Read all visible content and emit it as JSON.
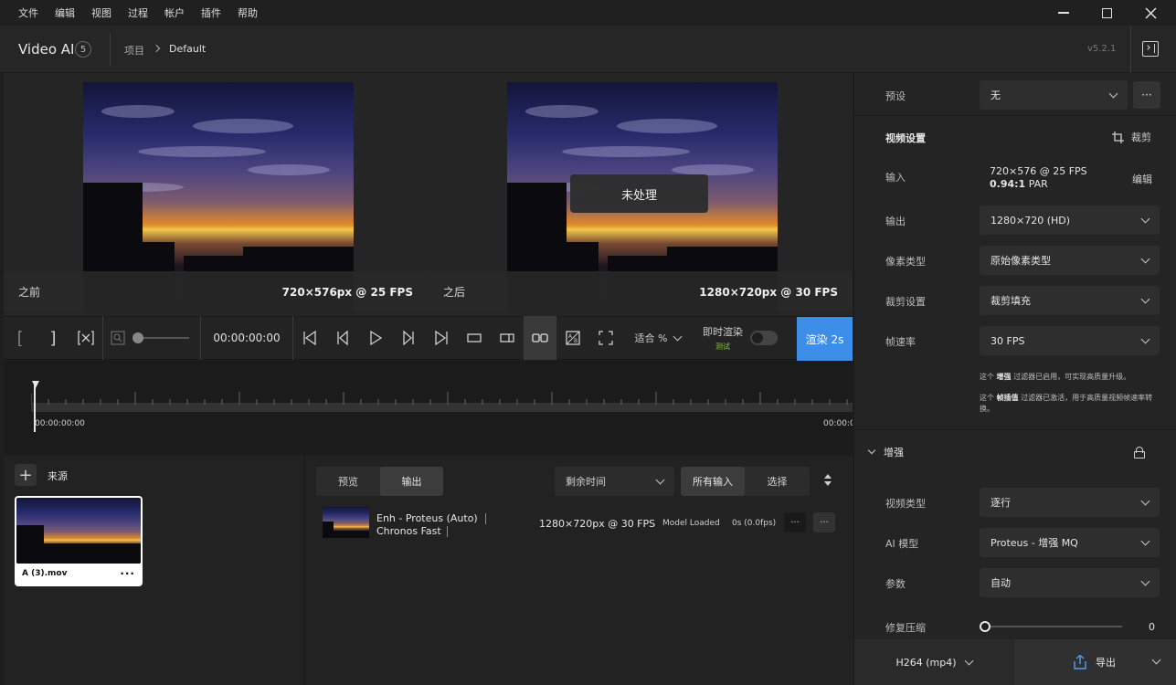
{
  "menubar": {
    "items": [
      "文件",
      "编辑",
      "视图",
      "过程",
      "帐户",
      "插件",
      "帮助"
    ]
  },
  "header": {
    "app_name": "Video AI",
    "badge": "5",
    "breadcrumb_parent": "项目",
    "breadcrumb_current": "Default",
    "version": "v5.2.1"
  },
  "preview": {
    "before_label": "之前",
    "before_info": "720×576px @ 25 FPS",
    "after_label": "之后",
    "after_info": "1280×720px @ 30 FPS",
    "unprocessed": "未处理"
  },
  "toolbar": {
    "timecode": "00:00:00:00",
    "fit_label": "适合 %",
    "instant_render": "即时渲染",
    "test_label": "测试",
    "render_button": "渲染 2s"
  },
  "timeline": {
    "start_time": "00:00:00:00",
    "end_time": "00:00:0"
  },
  "sources": {
    "title": "来源",
    "file_name": "A (3).mov"
  },
  "outputs": {
    "tab_preview": "预览",
    "tab_output": "输出",
    "sort_label": "剩余时间",
    "filter_all": "所有输入",
    "filter_select": "选择",
    "row": {
      "model_line1": "Enh - Proteus (Auto)",
      "model_line2": "Chronos Fast",
      "resolution": "1280×720px @ 30 FPS",
      "status": "Model Loaded",
      "time": "0s (0.0fps)"
    }
  },
  "rpanel": {
    "preset_label": "预设",
    "preset_value": "无",
    "video_settings": "视频设置",
    "crop_label": "裁剪",
    "input_label": "输入",
    "input_line1": "720×576 @ 25 FPS",
    "input_par_value": "0.94:1",
    "input_par_unit": "PAR",
    "edit_label": "编辑",
    "output_label": "输出",
    "output_value": "1280×720 (HD)",
    "pixel_label": "像素类型",
    "pixel_value": "原始像素类型",
    "cropset_label": "裁剪设置",
    "cropset_value": "裁剪填充",
    "fps_label": "帧速率",
    "fps_value": "30 FPS",
    "note1_pre": "这个",
    "note1_bold": "增强",
    "note1_post": "过滤器已启用，可实现高质量升级。",
    "note2_pre": "这个",
    "note2_bold": "帧插值",
    "note2_post": "过滤器已激活，用于高质量视频帧速率转换。",
    "enhance_title": "增强",
    "vtype_label": "视频类型",
    "vtype_value": "逐行",
    "ai_label": "AI 模型",
    "ai_value": "Proteus - 增强 MQ",
    "param_label": "参数",
    "param_value": "自动",
    "repair_label": "修复压缩",
    "repair_value": "0",
    "format": "H264 (mp4)",
    "export": "导出"
  }
}
